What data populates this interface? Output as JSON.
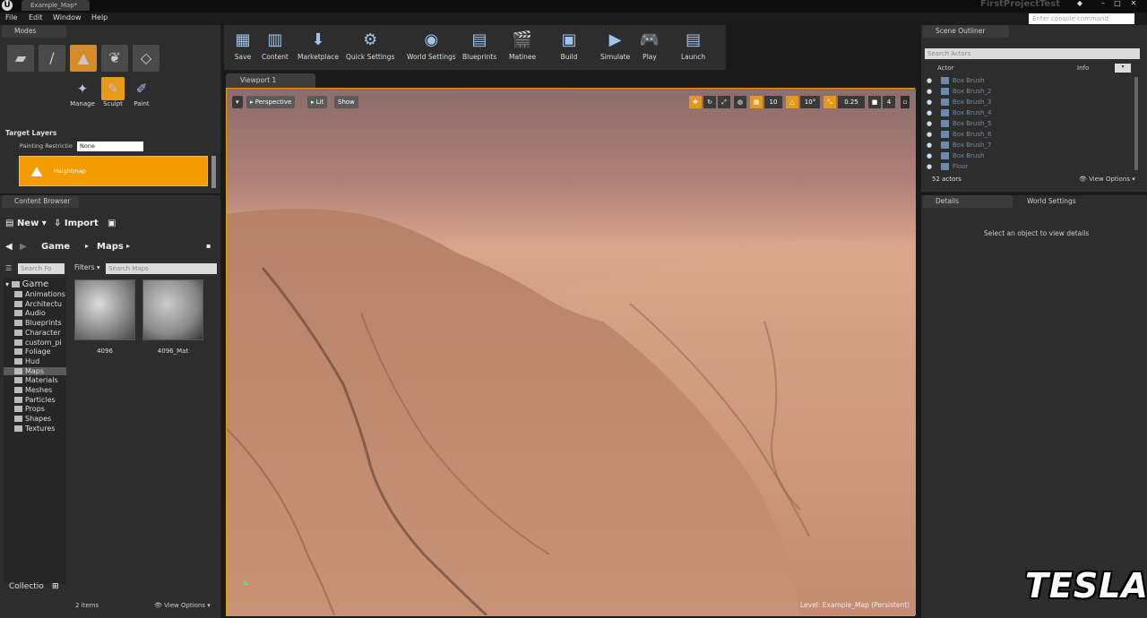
{
  "titlebar": {
    "tab": "Example_Map*",
    "project": "FirstProjectTest"
  },
  "menu": [
    "File",
    "Edit",
    "Window",
    "Help"
  ],
  "console": {
    "placeholder": "Enter console command"
  },
  "modes": {
    "tab": "Modes",
    "tools": [
      {
        "label": "Manage",
        "icon": "manage-icon"
      },
      {
        "label": "Sculpt",
        "icon": "sculpt-icon"
      },
      {
        "label": "Paint",
        "icon": "paint-icon"
      }
    ],
    "target_layers": "Target Layers",
    "painting_restriction_label": "Painting Restrictio",
    "painting_restriction_value": "None",
    "layer": "Heightmap"
  },
  "content_browser": {
    "tab": "Content Browser",
    "new": "New",
    "import": "Import",
    "breadcrumb": [
      "Game",
      "Maps"
    ],
    "search_folders_placeholder": "Search Fo",
    "filters": "Filters",
    "search_maps_placeholder": "Search Maps",
    "tree_root": "Game",
    "tree": [
      "Animations",
      "Architectu",
      "Audio",
      "Blueprints",
      "Character",
      "custom_pi",
      "Foliage",
      "Hud",
      "Maps",
      "Materials",
      "Meshes",
      "Particles",
      "Props",
      "Shapes",
      "Textures"
    ],
    "selected_folder": "Maps",
    "assets": [
      "4096",
      "4096_Mat"
    ],
    "collections": "Collectio",
    "item_count": "2 items",
    "view_options": "View Options"
  },
  "toolbar": [
    {
      "label": "Save",
      "icon": "save-icon"
    },
    {
      "label": "Content",
      "icon": "content-icon"
    },
    {
      "label": "Marketplace",
      "icon": "marketplace-icon"
    },
    {
      "label": "Quick Settings",
      "icon": "quick-settings-icon"
    },
    {
      "label": "World Settings",
      "icon": "world-settings-icon"
    },
    {
      "label": "Blueprints",
      "icon": "blueprints-icon"
    },
    {
      "label": "Matinee",
      "icon": "matinee-icon"
    },
    {
      "label": "Build",
      "icon": "build-icon"
    },
    {
      "label": "Simulate",
      "icon": "simulate-icon"
    },
    {
      "label": "Play",
      "icon": "play-icon"
    },
    {
      "label": "Launch",
      "icon": "launch-icon"
    }
  ],
  "viewport": {
    "tab": "Viewport 1",
    "perspective": "Perspective",
    "lit": "Lit",
    "show": "Show",
    "grid_snap": "10",
    "rot_snap": "10°",
    "scale_snap": "0.25",
    "cam_speed": "4",
    "level": "Level:  Example_Map (Persistent)"
  },
  "outliner": {
    "tab": "Scene Outliner",
    "search_placeholder": "Search Actors",
    "col_actor": "Actor",
    "col_info": "Info",
    "actors": [
      "Box Brush",
      "Box Brush_2",
      "Box Brush_3",
      "Box Brush_4",
      "Box Brush_5",
      "Box Brush_6",
      "Box Brush_7",
      "Box Brush",
      "Floor"
    ],
    "count": "52 actors",
    "view_options": "View Options"
  },
  "details": {
    "tab": "Details",
    "world_settings_tab": "World Settings",
    "empty_message": "Select an object to view details"
  },
  "watermark": "TESLA"
}
